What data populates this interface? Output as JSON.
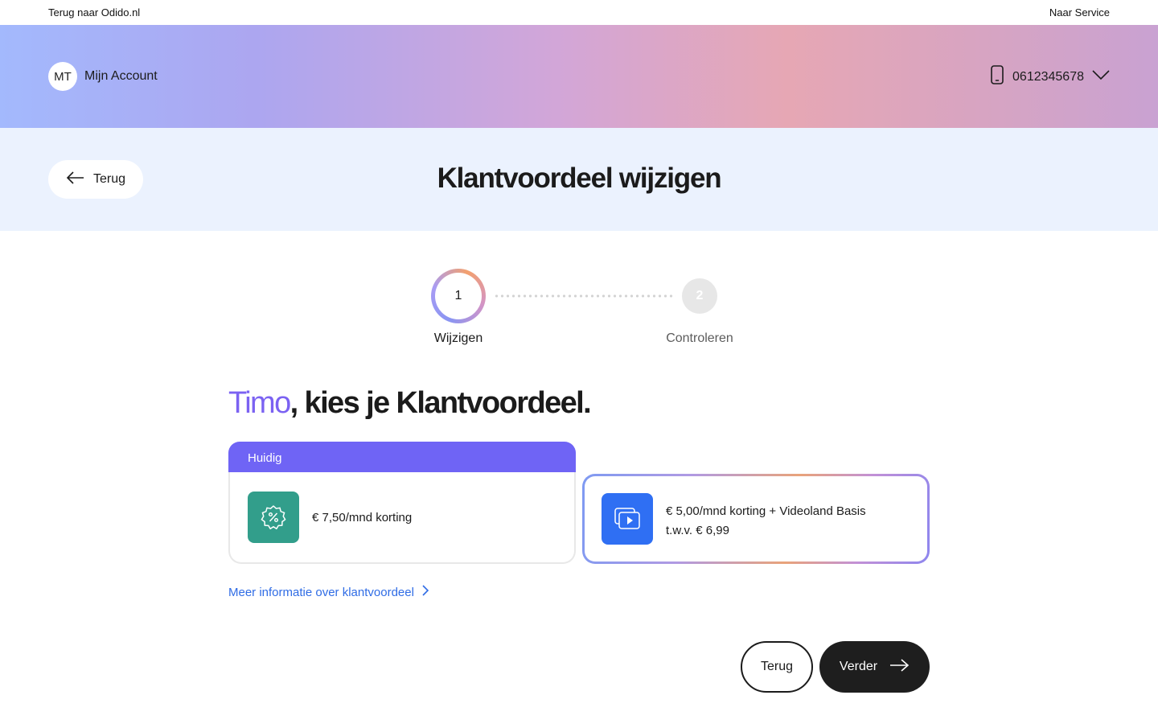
{
  "topbar": {
    "back_link": "Terug naar Odido.nl",
    "service_link": "Naar Service"
  },
  "header": {
    "avatar_initials": "MT",
    "account_label": "Mijn Account",
    "phone_number": "0612345678"
  },
  "titlebar": {
    "back_label": "Terug",
    "title": "Klantvoordeel wijzigen"
  },
  "stepper": {
    "steps": [
      {
        "number": "1",
        "label": "Wijzigen",
        "state": "active"
      },
      {
        "number": "2",
        "label": "Controleren",
        "state": "inactive"
      }
    ]
  },
  "main": {
    "heading_name": "Timo",
    "heading_rest": ", kies je Klantvoordeel.",
    "current": {
      "tab_label": "Huidig",
      "text": "€ 7,50/mnd korting",
      "icon": "discount-badge-icon"
    },
    "option": {
      "line1": "€ 5,00/mnd korting + Videoland Basis",
      "line2": "t.w.v. € 6,99",
      "icon": "video-play-icon"
    },
    "more_link": "Meer informatie over klantvoordeel"
  },
  "footer": {
    "back_label": "Terug",
    "next_label": "Verder"
  },
  "colors": {
    "accent_purple": "#6f64f5",
    "link_blue": "#2f6ce5",
    "tile_green": "#329e8b",
    "tile_blue": "#2f6ff3",
    "dark_button": "#1e1e1e"
  }
}
